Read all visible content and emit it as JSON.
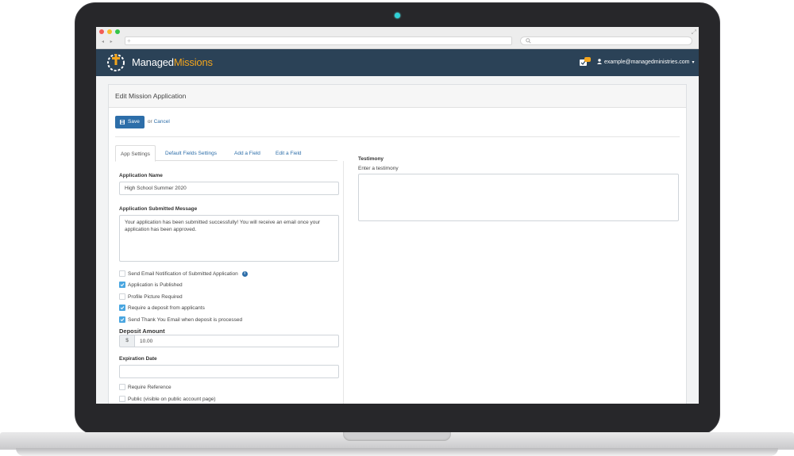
{
  "browser": {
    "new_tab": "+"
  },
  "navbar": {
    "brand_part1": "Managed",
    "brand_part2": "Missions",
    "notification_count": "15",
    "user_email": "example@managedministries.com"
  },
  "page": {
    "title": "Edit Mission Application",
    "save_label": "Save",
    "or_text": "or",
    "cancel_label": "Cancel"
  },
  "tabs": [
    {
      "label": "App Settings",
      "active": true
    },
    {
      "label": "Default Fields Settings",
      "active": false
    },
    {
      "label": "Add a Field",
      "active": false
    },
    {
      "label": "Edit a Field",
      "active": false
    }
  ],
  "form": {
    "application_name_label": "Application Name",
    "application_name_value": "High School Summer 2020",
    "submitted_message_label": "Application Submitted Message",
    "submitted_message_value": "Your application has been submitted successfully! You will receive an email once your application has been approved.",
    "checkboxes": [
      {
        "label": "Send Email Notification of Submitted Application",
        "checked": false,
        "info": true
      },
      {
        "label": "Application is Published",
        "checked": true
      },
      {
        "label": "Profile Picture Required",
        "checked": false
      },
      {
        "label": "Require a deposit from applicants",
        "checked": true
      },
      {
        "label": "Send Thank You Email when deposit is processed",
        "checked": true
      }
    ],
    "deposit_label": "Deposit Amount",
    "deposit_currency": "$",
    "deposit_value": "10.00",
    "expiration_label": "Expiration Date",
    "expiration_value": "",
    "bottom_checkboxes": [
      {
        "label": "Require Reference",
        "checked": false
      },
      {
        "label": "Public (visible on public account page)",
        "checked": false
      }
    ]
  },
  "testimony": {
    "label": "Testimony",
    "placeholder": "Enter a testimony"
  },
  "colors": {
    "navbar_bg": "#2b4257",
    "brand_accent": "#f3a51d",
    "primary": "#2d6ea9",
    "checkbox_on": "#4aa6e0"
  },
  "icons": [
    "search-icon",
    "logo-compass-icon",
    "notification-icon",
    "user-icon",
    "save-icon",
    "info-icon",
    "check-icon"
  ]
}
